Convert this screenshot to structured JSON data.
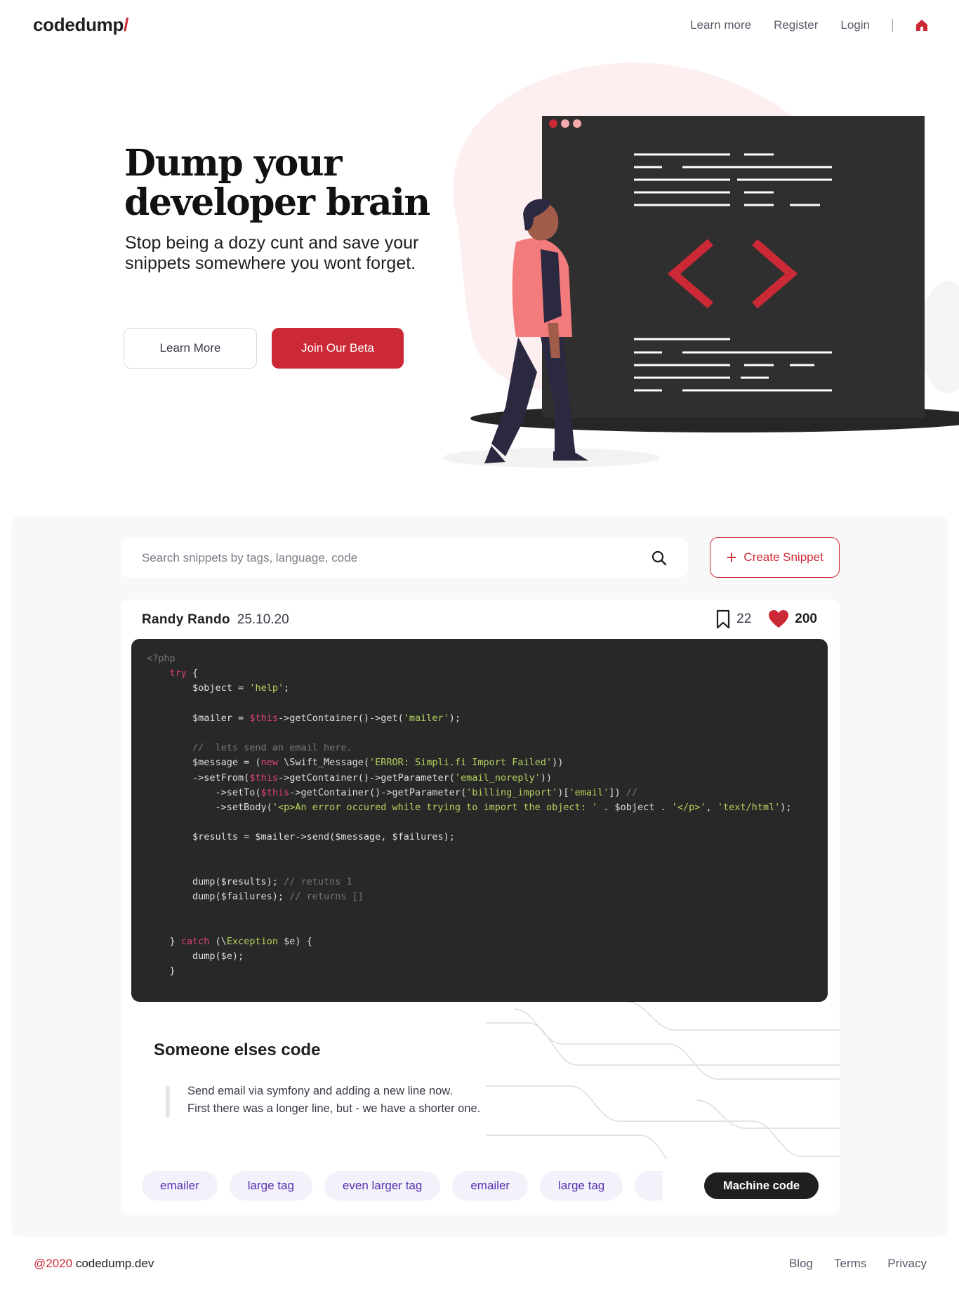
{
  "header": {
    "logo_text": "codedump",
    "logo_slash": "/",
    "nav": {
      "learn_more": "Learn more",
      "register": "Register",
      "login": "Login",
      "home_icon": "home-icon"
    }
  },
  "hero": {
    "title_line1": "Dump your",
    "title_line2": "developer brain",
    "subtitle": "Stop being a dozy cunt and save your snippets somewhere you wont forget.",
    "learn_more_button": "Learn More",
    "beta_button": "Join Our Beta"
  },
  "search": {
    "placeholder": "Search snippets by tags, language, code",
    "icon": "search-icon"
  },
  "create_button": "Create Snippet",
  "snippet": {
    "author": "Randy Rando",
    "date": "25.10.20",
    "bookmarks": "22",
    "likes": "200",
    "code_lines": [
      [
        [
          "c",
          "<?php"
        ]
      ],
      [
        [
          "p",
          "    "
        ],
        [
          "k",
          "try"
        ],
        [
          "p",
          " {"
        ]
      ],
      [
        [
          "p",
          "        $object = "
        ],
        [
          "s",
          "'help'"
        ],
        [
          "p",
          ";"
        ]
      ],
      [
        [
          "p",
          ""
        ]
      ],
      [
        [
          "p",
          "        $mailer = "
        ],
        [
          "k",
          "$this"
        ],
        [
          "p",
          "->getContainer()->get("
        ],
        [
          "s",
          "'mailer'"
        ],
        [
          "p",
          ");"
        ]
      ],
      [
        [
          "p",
          ""
        ]
      ],
      [
        [
          "c",
          "        //  lets send an email here."
        ]
      ],
      [
        [
          "p",
          "        $message = ("
        ],
        [
          "k",
          "new"
        ],
        [
          "p",
          " \\Swift_Message("
        ],
        [
          "s",
          "'ERROR: Simpli.fi Import Failed'"
        ],
        [
          "p",
          "))"
        ]
      ],
      [
        [
          "p",
          "        ->setFrom("
        ],
        [
          "k",
          "$this"
        ],
        [
          "p",
          "->getContainer()->getParameter("
        ],
        [
          "s",
          "'email_noreply'"
        ],
        [
          "p",
          "))"
        ]
      ],
      [
        [
          "p",
          "            ->setTo("
        ],
        [
          "k",
          "$this"
        ],
        [
          "p",
          "->getContainer()->getParameter("
        ],
        [
          "s",
          "'billing_import'"
        ],
        [
          "p",
          ")["
        ],
        [
          "s",
          "'email'"
        ],
        [
          "p",
          "]) "
        ],
        [
          "c",
          "//"
        ]
      ],
      [
        [
          "p",
          "            ->setBody("
        ],
        [
          "s",
          "'<p>An error occured while trying to import the object: '"
        ],
        [
          "p",
          " . $object . "
        ],
        [
          "s",
          "'</p>'"
        ],
        [
          "p",
          ", "
        ],
        [
          "s",
          "'text/html'"
        ],
        [
          "p",
          ");"
        ]
      ],
      [
        [
          "p",
          ""
        ]
      ],
      [
        [
          "p",
          "        $results = $mailer->send($message, $failures);"
        ]
      ],
      [
        [
          "p",
          ""
        ]
      ],
      [
        [
          "p",
          ""
        ]
      ],
      [
        [
          "p",
          "        dump($results); "
        ],
        [
          "c",
          "// retutns 1"
        ]
      ],
      [
        [
          "p",
          "        dump($failures); "
        ],
        [
          "c",
          "// returns []"
        ]
      ],
      [
        [
          "p",
          ""
        ]
      ],
      [
        [
          "p",
          ""
        ]
      ],
      [
        [
          "p",
          "    } "
        ],
        [
          "k",
          "catch"
        ],
        [
          "p",
          " (\\"
        ],
        [
          "s",
          "Exception"
        ],
        [
          "p",
          " $e) {"
        ]
      ],
      [
        [
          "p",
          "        dump($e);"
        ]
      ],
      [
        [
          "p",
          "    }"
        ]
      ]
    ],
    "title": "Someone elses code",
    "description_line1": "Send email via symfony and adding a new line now.",
    "description_line2": "First there was a longer line, but - we have a shorter one.",
    "tags": [
      "emailer",
      "large tag",
      "even larger tag",
      "emailer",
      "large tag"
    ],
    "language": "Machine code"
  },
  "footer": {
    "year": "@2020",
    "site": "codedump.dev",
    "links": [
      "Blog",
      "Terms",
      "Privacy"
    ]
  },
  "colors": {
    "accent": "#cc2936",
    "dark": "#282828",
    "tag_text": "#5a2fb2",
    "tag_bg": "#f3f2fa"
  }
}
